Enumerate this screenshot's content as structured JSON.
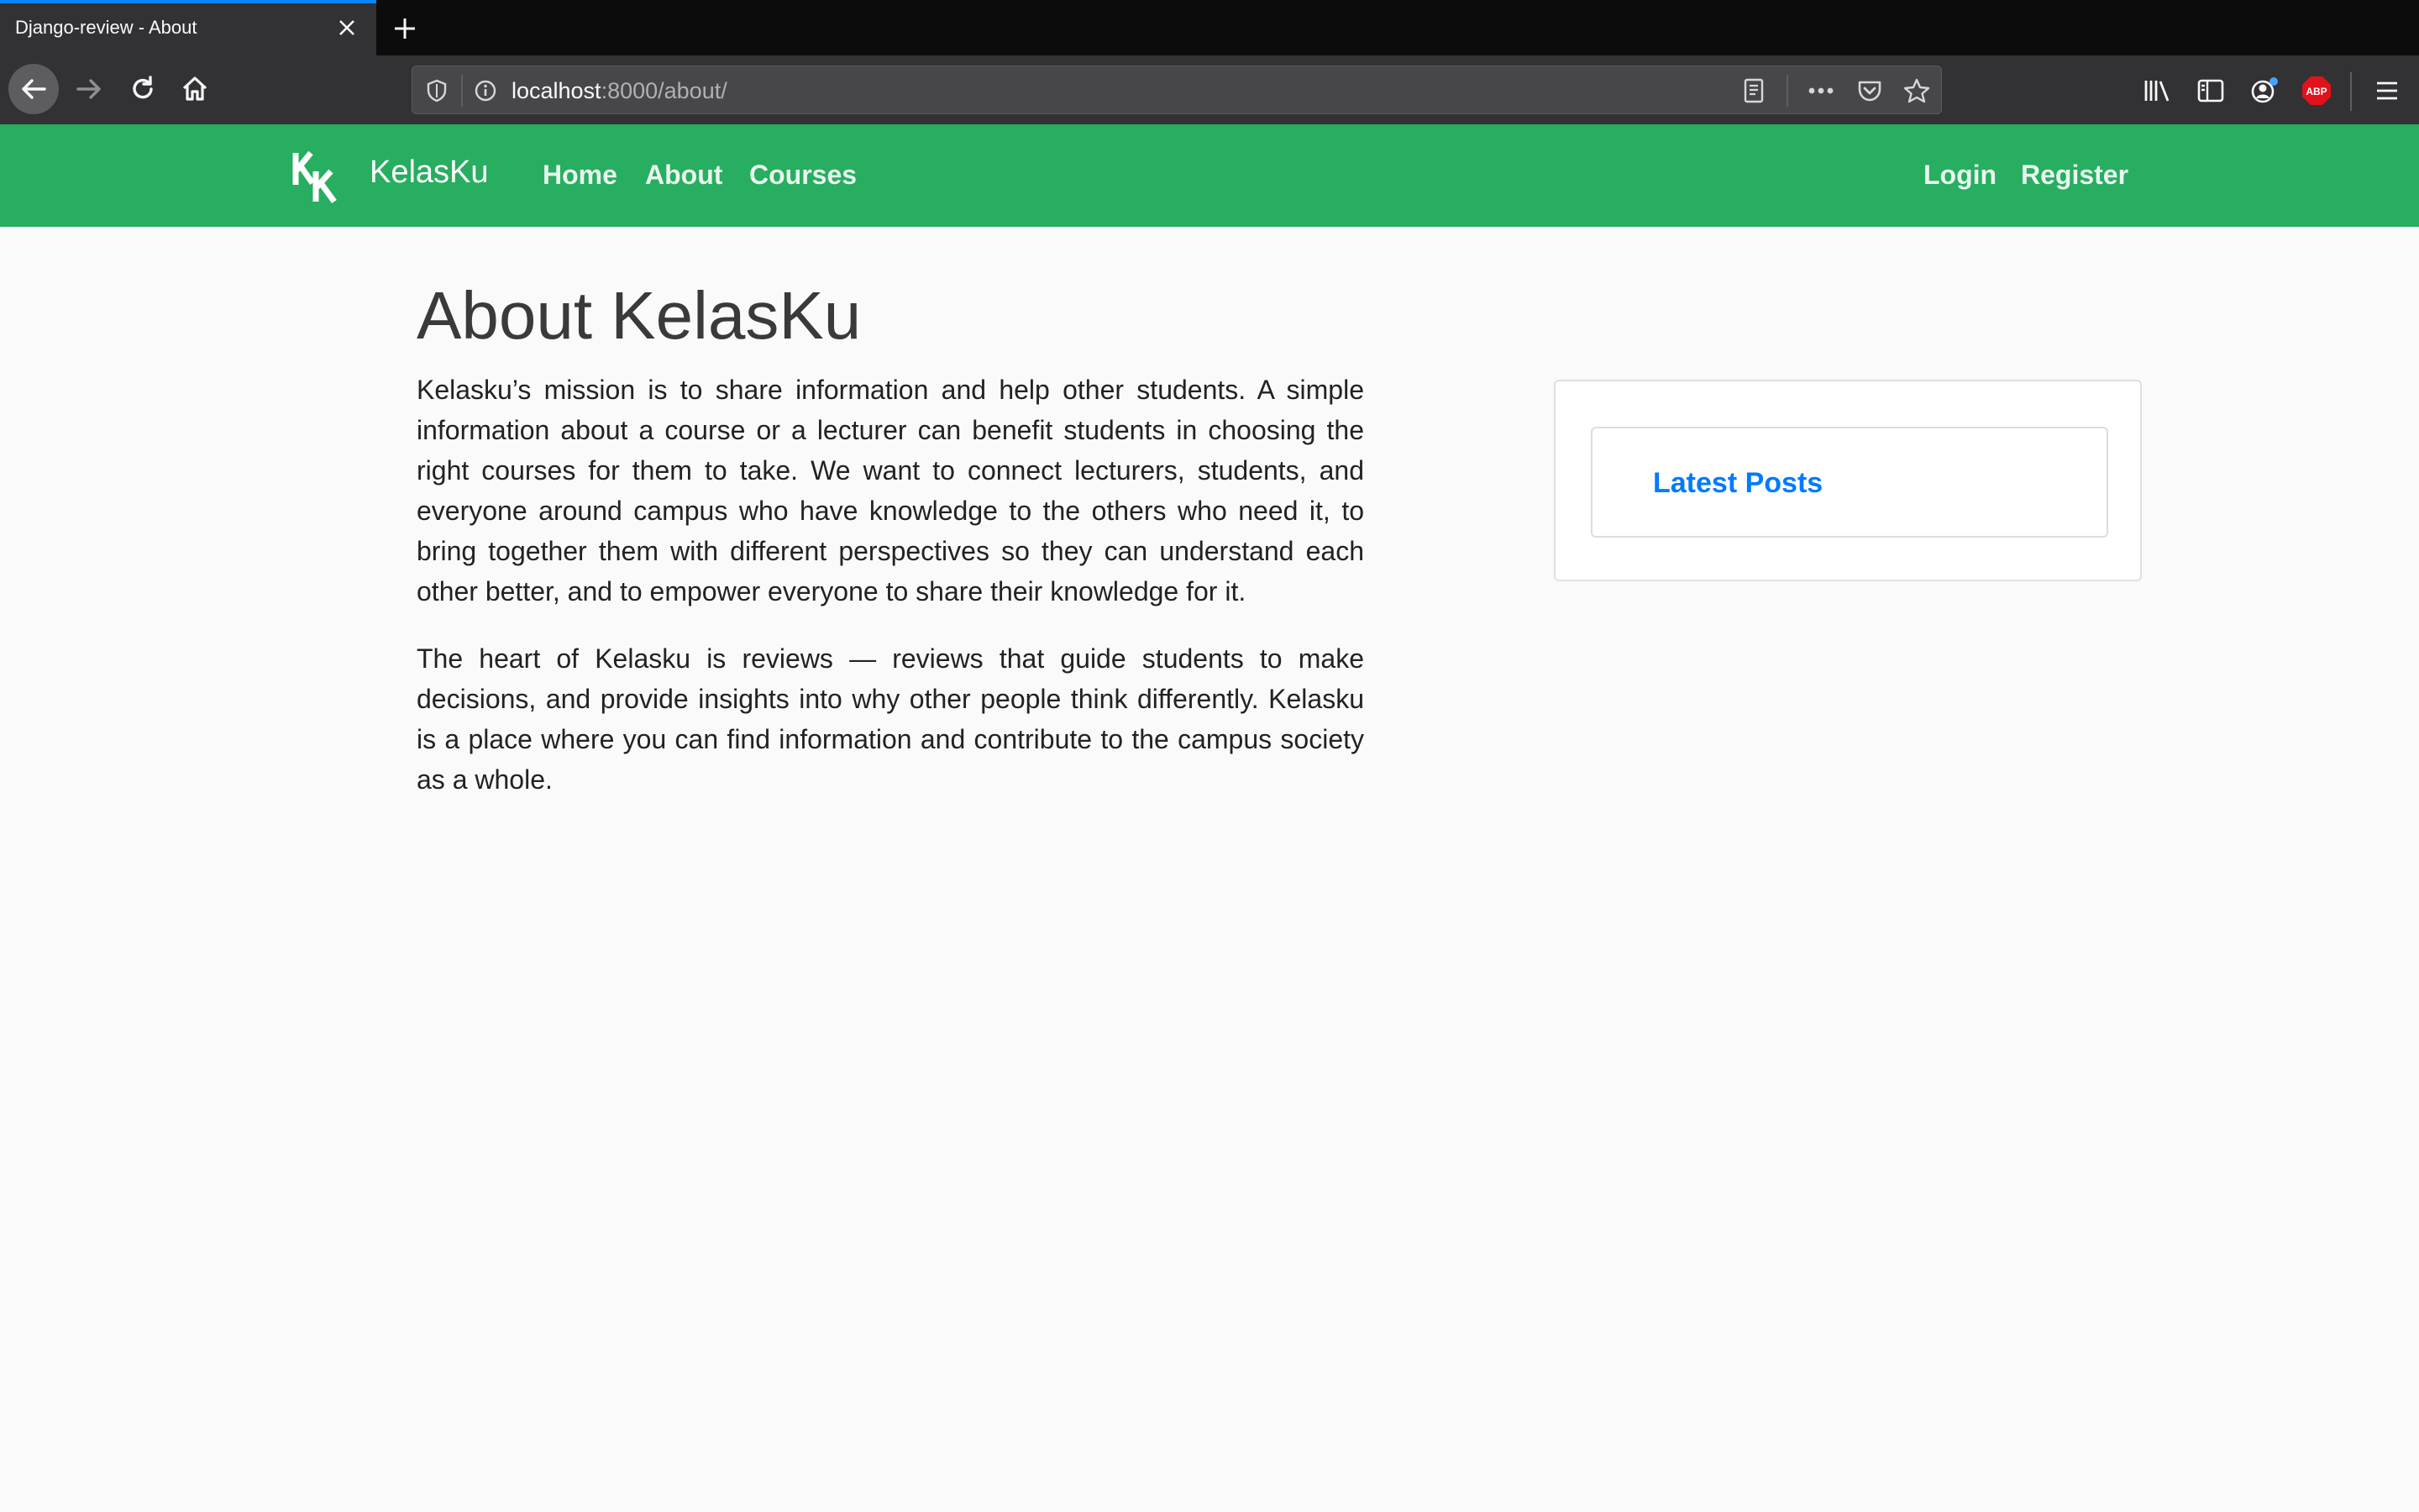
{
  "browser": {
    "tab_title": "Django-review - About",
    "url_host": "localhost",
    "url_path": ":8000/about/",
    "abp_label": "ABP"
  },
  "site": {
    "brand": "KelasKu",
    "nav_left": [
      "Home",
      "About",
      "Courses"
    ],
    "nav_right": [
      "Login",
      "Register"
    ],
    "accent_color": "#27ae60"
  },
  "main": {
    "title": "About KelasKu",
    "paragraph_1": "Kelasku’s mission is to share information and help other students. A simple information about a course or a lecturer can benefit students in choosing the right courses for them to take. We want to connect lecturers, students, and everyone around campus who have knowledge to the others who need it, to bring together them with different perspectives so they can understand each other better, and to empower everyone to share their knowledge for it.",
    "paragraph_2": "The heart of Kelasku is reviews — reviews that guide students to make decisions, and provide insights into why other people think differently. Kelasku is a place where you can find information and contribute to the campus society as a whole."
  },
  "sidebar": {
    "heading": "Latest Posts"
  }
}
